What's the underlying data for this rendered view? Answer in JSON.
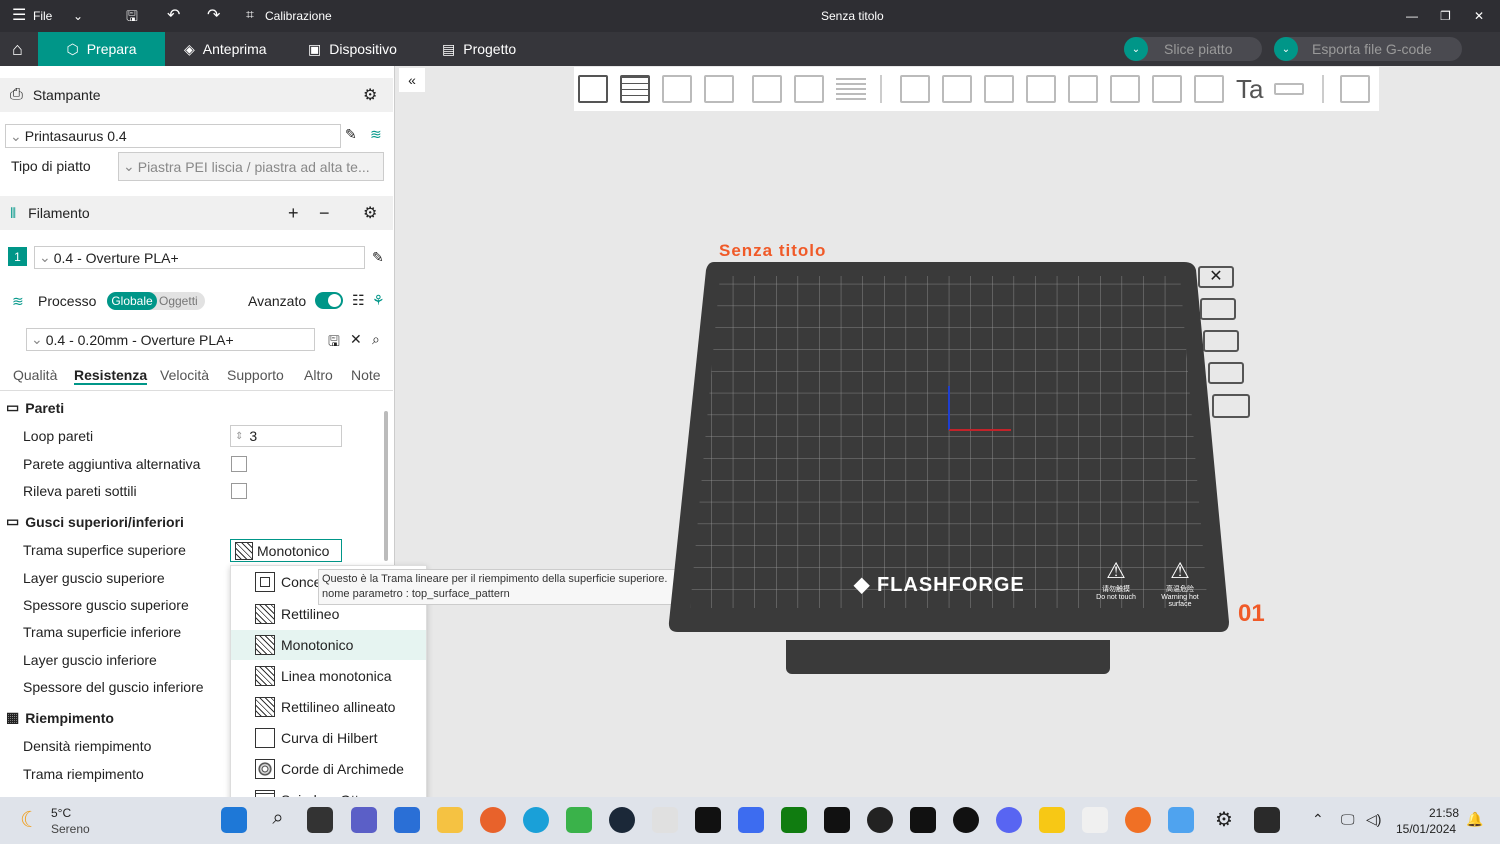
{
  "titlebar": {
    "file": "File",
    "calibration": "Calibrazione",
    "title": "Senza titolo",
    "minimize": "—",
    "restore": "❐",
    "close": "✕"
  },
  "nav": {
    "tabs": [
      {
        "label": "Prepara"
      },
      {
        "label": "Anteprima"
      },
      {
        "label": "Dispositivo"
      },
      {
        "label": "Progetto"
      }
    ],
    "slice": "Slice piatto",
    "export": "Esporta file G-code"
  },
  "printer": {
    "section": "Stampante",
    "name": "Printasaurus 0.4",
    "plate_label": "Tipo di piatto",
    "plate_value": "Piastra PEI liscia / piastra ad alta te..."
  },
  "filament": {
    "section": "Filamento",
    "index": "1",
    "name": "0.4 - Overture PLA+"
  },
  "process": {
    "section": "Processo",
    "global": "Globale",
    "objects": "Oggetti",
    "advanced": "Avanzato",
    "profile": "0.4 - 0.20mm - Overture PLA+"
  },
  "tabs": [
    "Qualità",
    "Resistenza",
    "Velocità",
    "Supporto",
    "Altro",
    "Note"
  ],
  "walls": {
    "title": "Pareti",
    "loops_label": "Loop pareti",
    "loops_value": "3",
    "alt_wall": "Parete aggiuntiva alternativa",
    "thin_walls": "Rileva pareti sottili"
  },
  "shells": {
    "title": "Gusci superiori/inferiori",
    "top_pattern": "Trama superfice superiore",
    "top_pattern_value": "Monotonico",
    "top_layers": "Layer guscio superiore",
    "top_thickness": "Spessore guscio superiore",
    "bottom_pattern": "Trama superficie inferiore",
    "bottom_layers": "Layer guscio inferiore",
    "bottom_thickness": "Spessore del guscio inferiore"
  },
  "infill": {
    "title": "Riempimento",
    "density": "Densità riempimento",
    "pattern": "Trama riempimento"
  },
  "dropdown": [
    "Concentrico",
    "Rettilineo",
    "Monotonico",
    "Linea monotonica",
    "Rettilineo allineato",
    "Curva di Hilbert",
    "Corde di Archimede",
    "Spirale a Ottogramma"
  ],
  "tooltip": {
    "line1": "Questo è la Trama lineare per il riempimento della superficie superiore.",
    "line2": "nome parametro    : top_surface_pattern"
  },
  "scene": {
    "plate_name": "Senza titolo",
    "plate_number": "01",
    "brand": "FLASHFORGE",
    "warn1": "Do not touch",
    "warn2": "Warning hot surface",
    "warn1_cn": "请勿触摸",
    "warn2_cn": "高温危险"
  },
  "weather": {
    "temp": "5°C",
    "desc": "Sereno"
  },
  "clock": {
    "time": "21:58",
    "date": "15/01/2024"
  },
  "colors": {
    "accent": "#009688",
    "bed": "#3a3a3a",
    "plate_label": "#f05a28"
  }
}
